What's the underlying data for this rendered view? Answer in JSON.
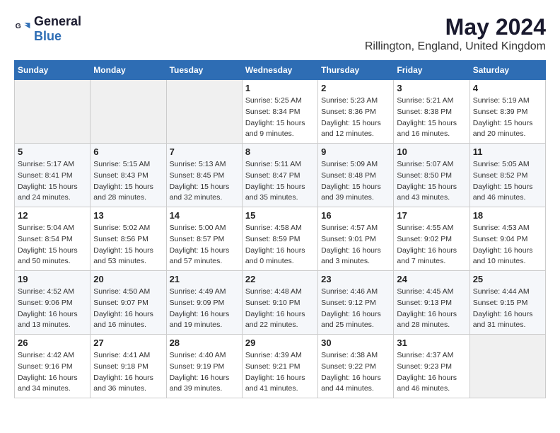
{
  "header": {
    "logo": {
      "text_general": "General",
      "text_blue": "Blue"
    },
    "title": "May 2024",
    "subtitle": "Rillington, England, United Kingdom"
  },
  "weekdays": [
    "Sunday",
    "Monday",
    "Tuesday",
    "Wednesday",
    "Thursday",
    "Friday",
    "Saturday"
  ],
  "weeks": [
    [
      {
        "day": "",
        "empty": true
      },
      {
        "day": "",
        "empty": true
      },
      {
        "day": "",
        "empty": true
      },
      {
        "day": "1",
        "sunrise": "5:25 AM",
        "sunset": "8:34 PM",
        "daylight": "15 hours and 9 minutes."
      },
      {
        "day": "2",
        "sunrise": "5:23 AM",
        "sunset": "8:36 PM",
        "daylight": "15 hours and 12 minutes."
      },
      {
        "day": "3",
        "sunrise": "5:21 AM",
        "sunset": "8:38 PM",
        "daylight": "15 hours and 16 minutes."
      },
      {
        "day": "4",
        "sunrise": "5:19 AM",
        "sunset": "8:39 PM",
        "daylight": "15 hours and 20 minutes."
      }
    ],
    [
      {
        "day": "5",
        "sunrise": "5:17 AM",
        "sunset": "8:41 PM",
        "daylight": "15 hours and 24 minutes."
      },
      {
        "day": "6",
        "sunrise": "5:15 AM",
        "sunset": "8:43 PM",
        "daylight": "15 hours and 28 minutes."
      },
      {
        "day": "7",
        "sunrise": "5:13 AM",
        "sunset": "8:45 PM",
        "daylight": "15 hours and 32 minutes."
      },
      {
        "day": "8",
        "sunrise": "5:11 AM",
        "sunset": "8:47 PM",
        "daylight": "15 hours and 35 minutes."
      },
      {
        "day": "9",
        "sunrise": "5:09 AM",
        "sunset": "8:48 PM",
        "daylight": "15 hours and 39 minutes."
      },
      {
        "day": "10",
        "sunrise": "5:07 AM",
        "sunset": "8:50 PM",
        "daylight": "15 hours and 43 minutes."
      },
      {
        "day": "11",
        "sunrise": "5:05 AM",
        "sunset": "8:52 PM",
        "daylight": "15 hours and 46 minutes."
      }
    ],
    [
      {
        "day": "12",
        "sunrise": "5:04 AM",
        "sunset": "8:54 PM",
        "daylight": "15 hours and 50 minutes."
      },
      {
        "day": "13",
        "sunrise": "5:02 AM",
        "sunset": "8:56 PM",
        "daylight": "15 hours and 53 minutes."
      },
      {
        "day": "14",
        "sunrise": "5:00 AM",
        "sunset": "8:57 PM",
        "daylight": "15 hours and 57 minutes."
      },
      {
        "day": "15",
        "sunrise": "4:58 AM",
        "sunset": "8:59 PM",
        "daylight": "16 hours and 0 minutes."
      },
      {
        "day": "16",
        "sunrise": "4:57 AM",
        "sunset": "9:01 PM",
        "daylight": "16 hours and 3 minutes."
      },
      {
        "day": "17",
        "sunrise": "4:55 AM",
        "sunset": "9:02 PM",
        "daylight": "16 hours and 7 minutes."
      },
      {
        "day": "18",
        "sunrise": "4:53 AM",
        "sunset": "9:04 PM",
        "daylight": "16 hours and 10 minutes."
      }
    ],
    [
      {
        "day": "19",
        "sunrise": "4:52 AM",
        "sunset": "9:06 PM",
        "daylight": "16 hours and 13 minutes."
      },
      {
        "day": "20",
        "sunrise": "4:50 AM",
        "sunset": "9:07 PM",
        "daylight": "16 hours and 16 minutes."
      },
      {
        "day": "21",
        "sunrise": "4:49 AM",
        "sunset": "9:09 PM",
        "daylight": "16 hours and 19 minutes."
      },
      {
        "day": "22",
        "sunrise": "4:48 AM",
        "sunset": "9:10 PM",
        "daylight": "16 hours and 22 minutes."
      },
      {
        "day": "23",
        "sunrise": "4:46 AM",
        "sunset": "9:12 PM",
        "daylight": "16 hours and 25 minutes."
      },
      {
        "day": "24",
        "sunrise": "4:45 AM",
        "sunset": "9:13 PM",
        "daylight": "16 hours and 28 minutes."
      },
      {
        "day": "25",
        "sunrise": "4:44 AM",
        "sunset": "9:15 PM",
        "daylight": "16 hours and 31 minutes."
      }
    ],
    [
      {
        "day": "26",
        "sunrise": "4:42 AM",
        "sunset": "9:16 PM",
        "daylight": "16 hours and 34 minutes."
      },
      {
        "day": "27",
        "sunrise": "4:41 AM",
        "sunset": "9:18 PM",
        "daylight": "16 hours and 36 minutes."
      },
      {
        "day": "28",
        "sunrise": "4:40 AM",
        "sunset": "9:19 PM",
        "daylight": "16 hours and 39 minutes."
      },
      {
        "day": "29",
        "sunrise": "4:39 AM",
        "sunset": "9:21 PM",
        "daylight": "16 hours and 41 minutes."
      },
      {
        "day": "30",
        "sunrise": "4:38 AM",
        "sunset": "9:22 PM",
        "daylight": "16 hours and 44 minutes."
      },
      {
        "day": "31",
        "sunrise": "4:37 AM",
        "sunset": "9:23 PM",
        "daylight": "16 hours and 46 minutes."
      },
      {
        "day": "",
        "empty": true
      }
    ]
  ],
  "labels": {
    "sunrise": "Sunrise:",
    "sunset": "Sunset:",
    "daylight": "Daylight:"
  }
}
